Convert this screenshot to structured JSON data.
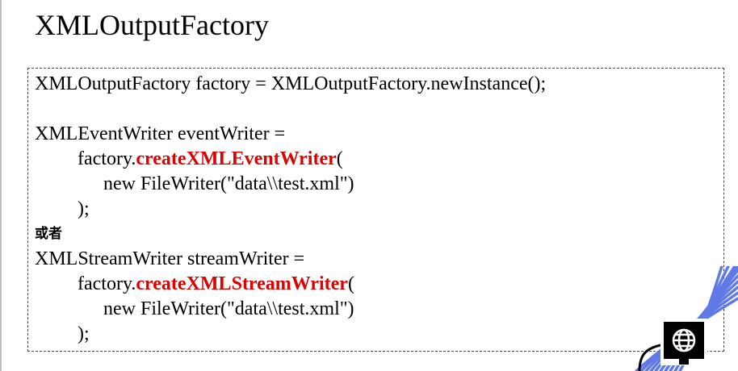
{
  "slide": {
    "title": "XMLOutputFactory"
  },
  "code": {
    "line1": "XMLOutputFactory factory = XMLOutputFactory.newInstance();",
    "event_decl": "XMLEventWriter eventWriter =",
    "event_call_prefix": "factory.",
    "event_call_method": "createXMLEventWriter",
    "event_call_open": "(",
    "event_arg": "new FileWriter(\"data\\\\test.xml\")",
    "event_close": ");",
    "or_label": "或者",
    "stream_decl": "XMLStreamWriter streamWriter =",
    "stream_call_prefix": "factory.",
    "stream_call_method": "createXMLStreamWriter",
    "stream_call_open": "(",
    "stream_arg": "new FileWriter(\"data\\\\test.xml\")",
    "stream_close": ");"
  },
  "colors": {
    "highlight": "#e00000",
    "decoration": "#5f79e6"
  },
  "decoration": {
    "icon": "globe-icon"
  }
}
